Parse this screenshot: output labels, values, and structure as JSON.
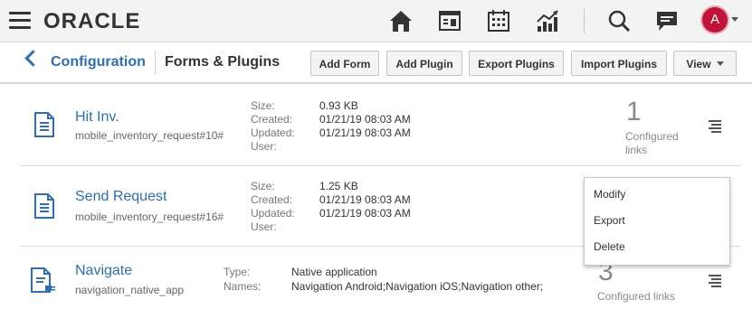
{
  "topbar": {
    "brand": "ORACLE",
    "icons": [
      "home-icon",
      "reports-icon",
      "calendar-icon",
      "analytics-icon",
      "search-icon",
      "chat-icon"
    ],
    "avatar_initial": "A"
  },
  "subheader": {
    "breadcrumb": "Configuration",
    "title": "Forms & Plugins",
    "buttons": {
      "add_form": "Add Form",
      "add_plugin": "Add Plugin",
      "export_plugins": "Export Plugins",
      "import_plugins": "Import Plugins",
      "view": "View"
    }
  },
  "items": [
    {
      "title": "Hit Inv.",
      "subtitle": "mobile_inventory_request#10#",
      "meta_labels": [
        "Size:",
        "Created:",
        "Updated:",
        "User:"
      ],
      "meta_values": [
        "0.93 KB",
        "01/21/19 08:03 AM",
        "01/21/19 08:03 AM",
        ""
      ],
      "count": "1",
      "count_label_line1": "Configured",
      "count_label_line2": "links"
    },
    {
      "title": "Send Request",
      "subtitle": "mobile_inventory_request#16#",
      "meta_labels": [
        "Size:",
        "Created:",
        "Updated:",
        "User:"
      ],
      "meta_values": [
        "1.25 KB",
        "01/21/19 08:03 AM",
        "01/21/19 08:03 AM",
        ""
      ]
    },
    {
      "title": "Navigate",
      "subtitle": "navigation_native_app",
      "meta_labels": [
        "Type:",
        "Names:"
      ],
      "meta_values": [
        "Native application",
        "Navigation Android;Navigation iOS;Navigation other;"
      ],
      "count": "3",
      "count_label": "Configured links"
    }
  ],
  "context_menu": {
    "items": [
      "Modify",
      "Export",
      "Delete"
    ]
  },
  "colors": {
    "link": "#2f6fad",
    "avatar": "#c1133a",
    "topbar_bg": "#f3f3f3"
  }
}
